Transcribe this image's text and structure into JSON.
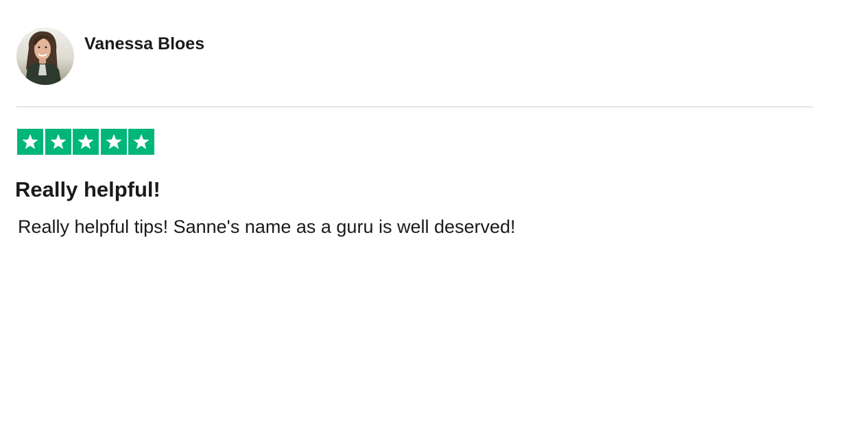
{
  "reviewer": {
    "name": "Vanessa Bloes",
    "avatar_icon": "user-photo-avatar"
  },
  "rating": {
    "stars": 5,
    "max_stars": 5,
    "star_color": "#00b67a",
    "star_icon": "star-icon"
  },
  "review": {
    "title": "Really helpful!",
    "body": "Really helpful tips! Sanne's name as a guru is well deserved!"
  },
  "colors": {
    "text": "#1a1a1a",
    "divider": "#e6e6e6",
    "background": "#ffffff"
  }
}
